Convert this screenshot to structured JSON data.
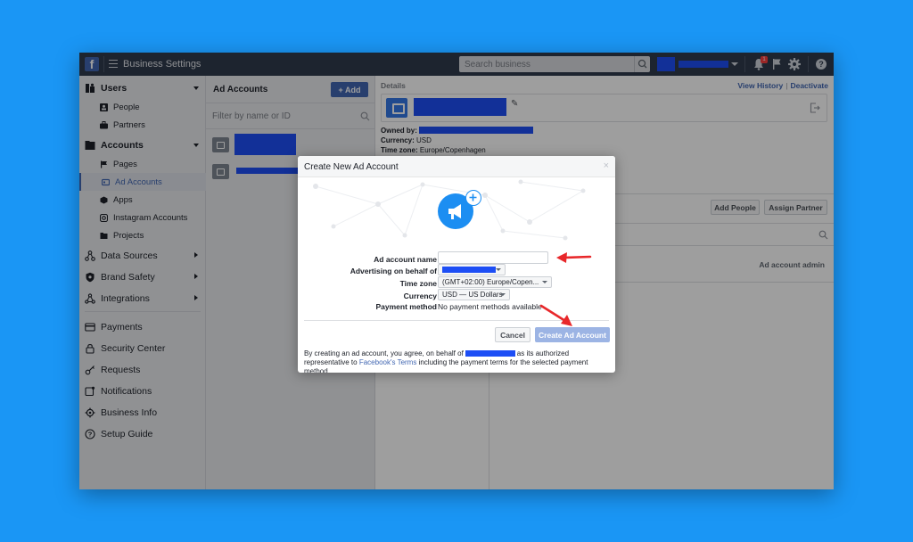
{
  "topbar": {
    "logo": "f",
    "title": "Business Settings",
    "search_placeholder": "Search business",
    "notification_count": "1",
    "help_label": "?"
  },
  "sidebar": {
    "users": {
      "label": "Users",
      "items": [
        "People",
        "Partners"
      ]
    },
    "accounts": {
      "label": "Accounts",
      "items": [
        "Pages",
        "Ad Accounts",
        "Apps",
        "Instagram Accounts",
        "Projects"
      ]
    },
    "data_sources": "Data Sources",
    "brand_safety": "Brand Safety",
    "integrations": "Integrations",
    "payments": "Payments",
    "security_center": "Security Center",
    "requests": "Requests",
    "notifications": "Notifications",
    "business_info": "Business Info",
    "setup_guide": "Setup Guide"
  },
  "ad_accounts": {
    "title": "Ad Accounts",
    "add_label": "+ Add",
    "filter_placeholder": "Filter by name or ID"
  },
  "details": {
    "label": "Details",
    "view_history": "View History",
    "separator": "|",
    "deactivate": "Deactivate",
    "owned_by_label": "Owned by:",
    "currency_label": "Currency:",
    "currency_value": "USD",
    "timezone_label": "Time zone:",
    "timezone_value": "Europe/Copenhagen",
    "add_people": "Add People",
    "assign_partner": "Assign Partner",
    "role": "Ad account admin"
  },
  "modal": {
    "title": "Create New Ad Account",
    "close": "×",
    "fields": {
      "name_label": "Ad account name",
      "behalf_label": "Advertising on behalf of",
      "timezone_label": "Time zone",
      "timezone_value": "(GMT+02:00) Europe/Copen...",
      "currency_label": "Currency",
      "currency_value": "USD — US Dollars",
      "payment_label": "Payment method",
      "payment_value": "No payment methods available"
    },
    "cancel": "Cancel",
    "create": "Create Ad Account",
    "legal_prefix": "By creating an ad account, you agree, on behalf of",
    "legal_mid": "as its authorized representative to",
    "legal_link": "Facebook's Terms",
    "legal_suffix": "including the payment terms for the selected payment method."
  },
  "colors": {
    "background": "#1a96f5",
    "topbar": "#2f3b4d",
    "accent": "#4267b2",
    "redaction": "#1d4ef5",
    "annotation_arrow": "#e8282b"
  }
}
